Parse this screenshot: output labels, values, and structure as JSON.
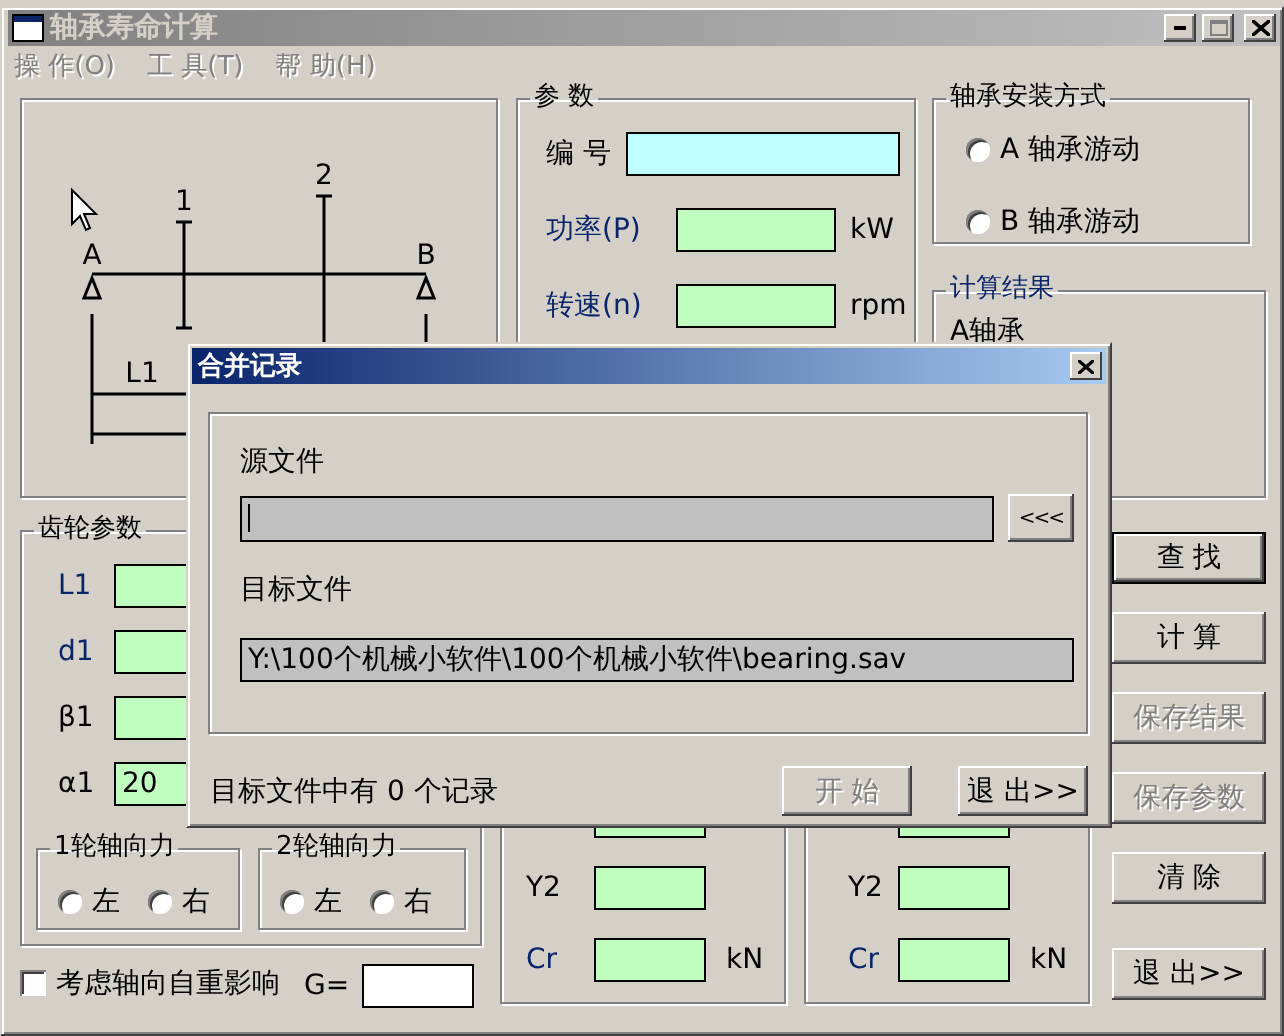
{
  "window": {
    "title": "轴承寿命计算",
    "active": false
  },
  "menu": [
    {
      "label": "操 作(O)",
      "disabled": true
    },
    {
      "label": "工 具(T)",
      "disabled": true
    },
    {
      "label": "帮 助(H)",
      "disabled": true
    }
  ],
  "diagram": {
    "bearings": [
      "A",
      "B"
    ],
    "gears": [
      "1",
      "2"
    ],
    "dimension": "L1"
  },
  "params": {
    "title": "参 数",
    "emphasis": false,
    "fields": [
      {
        "label": "编 号",
        "kind": "id",
        "emphasis": false
      },
      {
        "label": "功率(P)",
        "kind": "number",
        "emphasis": true,
        "unit": "kW"
      },
      {
        "label": "转速(n)",
        "kind": "number",
        "emphasis": true,
        "unit": "rpm"
      }
    ]
  },
  "mounting": {
    "title": "轴承安装方式",
    "emphasis": false,
    "options": [
      {
        "label": "A 轴承游动",
        "selected": false
      },
      {
        "label": "B 轴承游动",
        "selected": false
      }
    ]
  },
  "results": {
    "title": "计算结果",
    "emphasis": true,
    "lines": [
      "A轴承"
    ]
  },
  "gear_params": {
    "title": "齿轮参数",
    "emphasis": false,
    "fields": [
      {
        "label": "L1",
        "kind": "number",
        "emphasis": true
      },
      {
        "label": "d1",
        "kind": "number",
        "emphasis": true
      },
      {
        "label": "β1",
        "kind": "number",
        "emphasis": false
      },
      {
        "label": "α1",
        "kind": "number",
        "emphasis": false,
        "value": "20"
      }
    ],
    "axial_force": [
      {
        "title": "1轮轴向力",
        "options": [
          {
            "label": "左",
            "selected": false
          },
          {
            "label": "右",
            "selected": false
          }
        ]
      },
      {
        "title": "2轮轴向力",
        "options": [
          {
            "label": "左",
            "selected": false
          },
          {
            "label": "右",
            "selected": false
          }
        ]
      }
    ]
  },
  "self_weight": {
    "label": "考虑轴向自重影响",
    "checked": false,
    "field_label": "G=",
    "field": {
      "kind": "plain"
    }
  },
  "bearing_groups": [
    {
      "fields": [
        {
          "kind": "number"
        },
        {
          "label": "Y2",
          "kind": "number",
          "emphasis": false
        },
        {
          "label": "Cr",
          "kind": "number",
          "emphasis": true,
          "unit": "kN"
        }
      ]
    },
    {
      "fields": [
        {
          "kind": "number"
        },
        {
          "label": "Y2",
          "kind": "number",
          "emphasis": false
        },
        {
          "label": "Cr",
          "kind": "number",
          "emphasis": true,
          "unit": "kN"
        }
      ]
    }
  ],
  "buttons": [
    {
      "label": "查 找",
      "default": true,
      "disabled": false
    },
    {
      "label": "计 算",
      "default": false,
      "disabled": false
    },
    {
      "label": "保存结果",
      "default": false,
      "disabled": true
    },
    {
      "label": "保存参数",
      "default": false,
      "disabled": true
    },
    {
      "label": "清 除",
      "default": false,
      "disabled": false
    },
    {
      "label": "退 出>>",
      "default": false,
      "disabled": false
    }
  ],
  "dialog": {
    "title": "合并记录",
    "active": true,
    "source": {
      "label": "源文件",
      "kind": "path"
    },
    "browse_button": "<<<",
    "target": {
      "label": "目标文件",
      "kind": "path",
      "value": "Y:\\100个机械小软件\\100个机械小软件\\bearing.sav"
    },
    "status": "目标文件中有 0 个记录",
    "buttons": [
      {
        "label": "开 始",
        "disabled": true
      },
      {
        "label": "退 出>>",
        "disabled": false
      }
    ]
  }
}
